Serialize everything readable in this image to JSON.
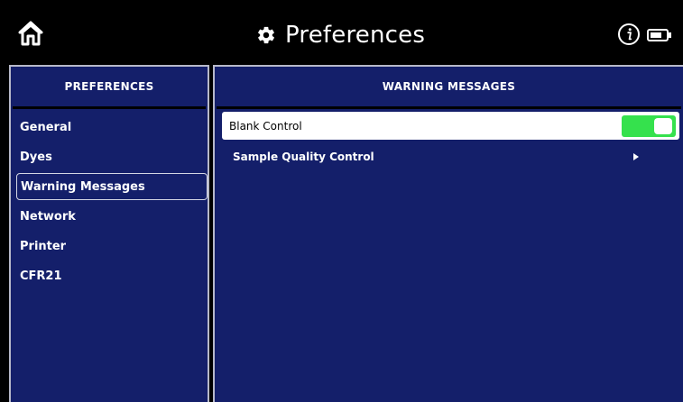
{
  "header": {
    "title": "Preferences",
    "home_icon": "home-icon",
    "settings_icon": "gear-icon",
    "info_icon": "info-icon",
    "battery_icon": "battery-icon"
  },
  "sidebar": {
    "heading": "PREFERENCES",
    "items": [
      {
        "label": "General"
      },
      {
        "label": "Dyes"
      },
      {
        "label": "Warning Messages"
      },
      {
        "label": "Network"
      },
      {
        "label": "Printer"
      },
      {
        "label": "CFR21"
      }
    ],
    "active_index": 2
  },
  "main": {
    "heading": "WARNING MESSAGES",
    "toggle_row": {
      "label": "Blank Control",
      "enabled": true
    },
    "submenu": {
      "label": "Sample Quality Control",
      "icon": "chevron-right-icon"
    }
  },
  "colors": {
    "panel_bg": "#141f6a",
    "toggle_on": "#35e14d",
    "border": "#b7b9c9"
  }
}
